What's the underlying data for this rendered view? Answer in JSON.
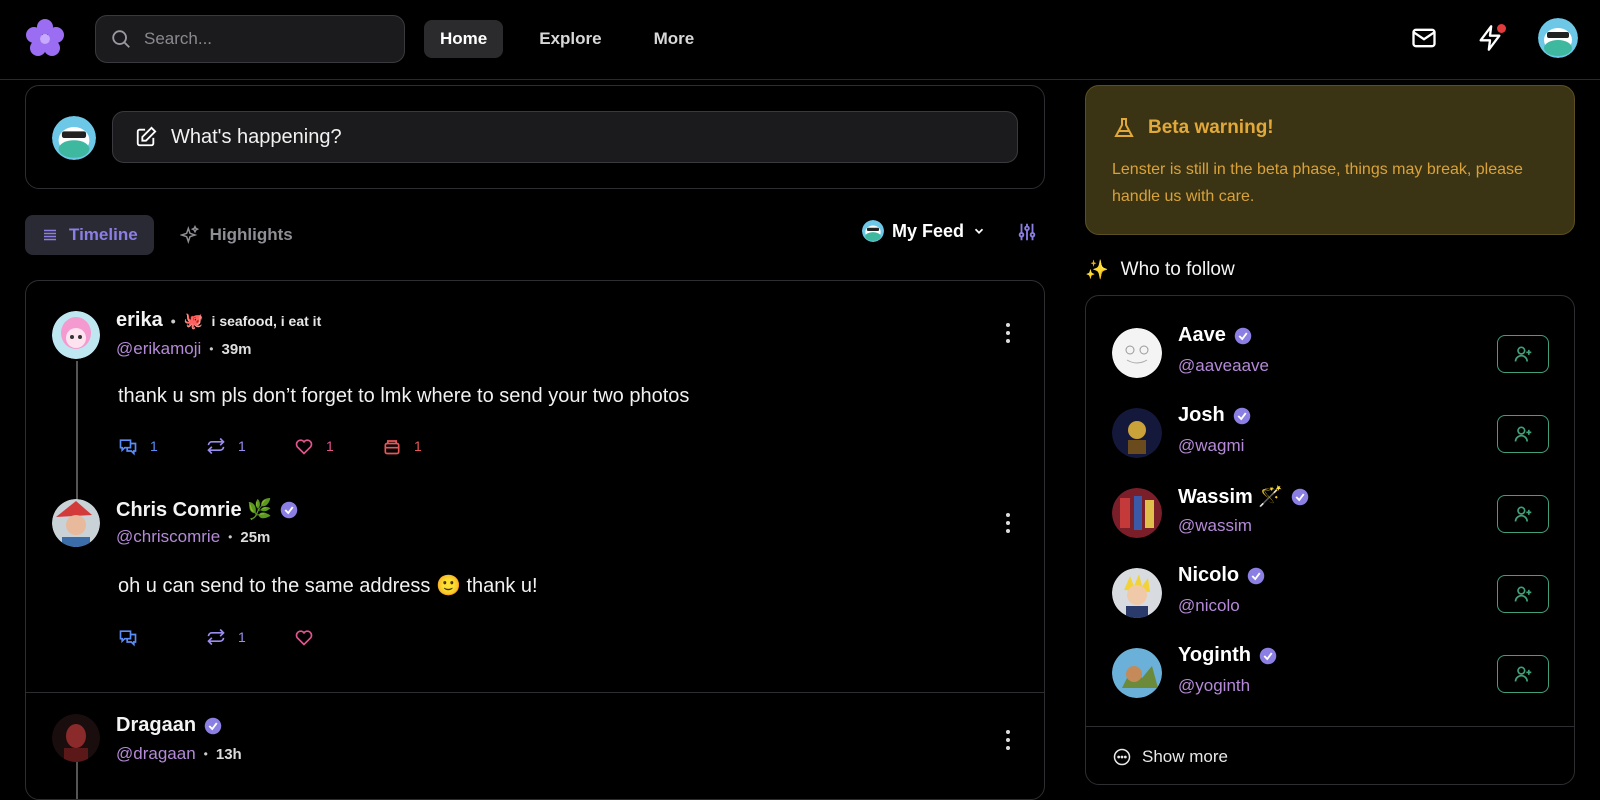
{
  "header": {
    "search_placeholder": "Search...",
    "nav": [
      {
        "label": "Home",
        "active": true
      },
      {
        "label": "Explore",
        "active": false
      },
      {
        "label": "More",
        "active": false
      }
    ],
    "notification_dot_color": "#e23b3b",
    "brand_color": "#8b5cf6"
  },
  "composer": {
    "placeholder": "What's happening?"
  },
  "tabs": [
    {
      "label": "Timeline",
      "icon": "list-icon",
      "active": true
    },
    {
      "label": "Highlights",
      "icon": "sparkles-icon",
      "active": false
    }
  ],
  "feed_select": {
    "label": "My Feed"
  },
  "posts": [
    {
      "name": "erika",
      "status_emoji": "🐙",
      "status_text": "i seafood, i eat it",
      "handle": "@erikamoji",
      "time": "39m",
      "body": "thank u sm pls don’t forget to lmk where to send your two photos",
      "actions": {
        "comments": "1",
        "mirrors": "1",
        "likes": "1",
        "collects": "1"
      }
    },
    {
      "name": "Chris Comrie 🌿",
      "handle": "@chriscomrie",
      "time": "25m",
      "body": "oh u can send to the same address 🙂 thank u!",
      "actions": {
        "comments": "",
        "mirrors": "1",
        "likes": ""
      }
    },
    {
      "name": "Dragaan",
      "handle": "@dragaan",
      "time": "13h"
    }
  ],
  "beta": {
    "title": "Beta warning!",
    "text": "Lenster is still in the beta phase, things may break, please handle us with care."
  },
  "who_to_follow": {
    "title": "Who to follow",
    "title_emoji": "✨",
    "users": [
      {
        "name": "Aave",
        "handle": "@aaveaave"
      },
      {
        "name": "Josh",
        "handle": "@wagmi"
      },
      {
        "name": "Wassim 🪄",
        "handle": "@wassim"
      },
      {
        "name": "Nicolo",
        "handle": "@nicolo"
      },
      {
        "name": "Yoginth",
        "handle": "@yoginth"
      }
    ],
    "show_more": "Show more"
  }
}
